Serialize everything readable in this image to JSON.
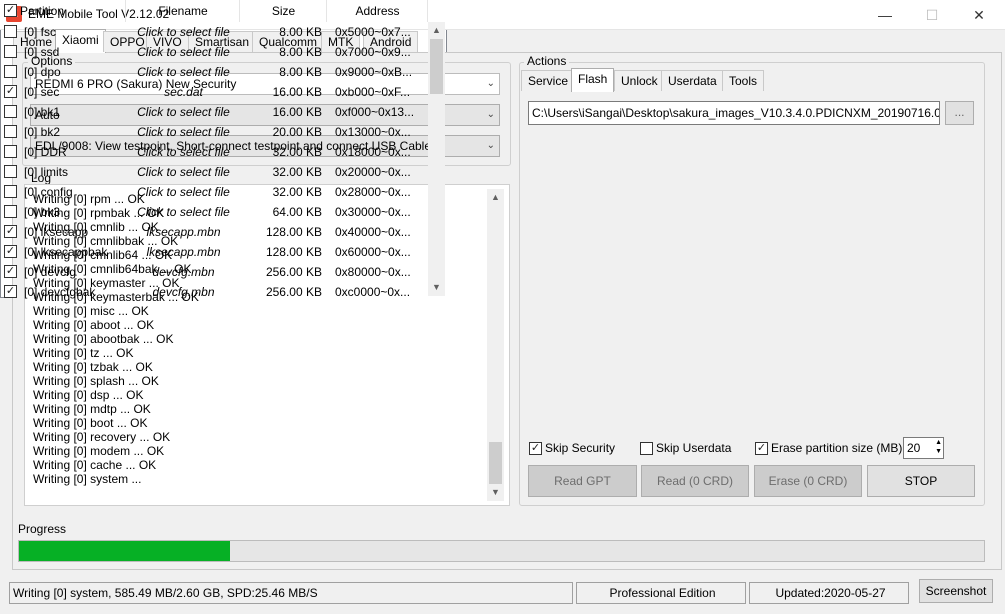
{
  "window": {
    "title": "EME Mobile Tool V2.12.02",
    "minimize": "—",
    "maximize": "☐",
    "close": "✕"
  },
  "tabs": [
    "Home",
    "Xiaomi",
    "OPPO",
    "VIVO",
    "Smartisan",
    "Qualcomm",
    "MTK",
    "Android"
  ],
  "options": {
    "label": "Options",
    "device": "REDMI 6 PRO (Sakura) New Security",
    "mode": "Auto",
    "connection": "EDL/9008: View testpoint, Short-connect testpoint and connect USB Cable"
  },
  "log": {
    "label": "Log",
    "lines": [
      "Writing [0] rpm ... OK",
      "Writing [0] rpmbak ... OK",
      "Writing [0] cmnlib ... OK",
      "Writing [0] cmnlibbak ... OK",
      "Writing [0] cmnlib64 ... OK",
      "Writing [0] cmnlib64bak ... OK",
      "Writing [0] keymaster ... OK",
      "Writing [0] keymasterbak ... OK",
      "Writing [0] misc ... OK",
      "Writing [0] aboot ... OK",
      "Writing [0] abootbak ... OK",
      "Writing [0] tz ... OK",
      "Writing [0] tzbak ... OK",
      "Writing [0] splash ... OK",
      "Writing [0] dsp ... OK",
      "Writing [0] mdtp ... OK",
      "Writing [0] boot ... OK",
      "Writing [0] recovery ... OK",
      "Writing [0] modem ... OK",
      "Writing [0] cache ... OK",
      "Writing [0] system ..."
    ]
  },
  "actions": {
    "label": "Actions",
    "subtabs": [
      "Service",
      "Flash",
      "Unlock",
      "Userdata",
      "Tools"
    ],
    "path": "C:\\Users\\iSangai\\Desktop\\sakura_images_V10.3.4.0.PDICNXM_20190716.0",
    "browse_label": "...",
    "table": {
      "headers": {
        "partition": "Partition",
        "filename": "Filename",
        "size": "Size",
        "address": "Address"
      },
      "rows": [
        {
          "checked": false,
          "partition": "[0] fsc",
          "filename": "Click to select file",
          "size": "8.00 KB",
          "address": "0x5000~0x7..."
        },
        {
          "checked": false,
          "partition": "[0] ssd",
          "filename": "Click to select file",
          "size": "8.00 KB",
          "address": "0x7000~0x9..."
        },
        {
          "checked": false,
          "partition": "[0] dpo",
          "filename": "Click to select file",
          "size": "8.00 KB",
          "address": "0x9000~0xB..."
        },
        {
          "checked": true,
          "partition": "[0] sec",
          "filename": "sec.dat",
          "size": "16.00 KB",
          "address": "0xb000~0xF..."
        },
        {
          "checked": false,
          "partition": "[0] bk1",
          "filename": "Click to select file",
          "size": "16.00 KB",
          "address": "0xf000~0x13..."
        },
        {
          "checked": false,
          "partition": "[0] bk2",
          "filename": "Click to select file",
          "size": "20.00 KB",
          "address": "0x13000~0x..."
        },
        {
          "checked": false,
          "partition": "[0] DDR",
          "filename": "Click to select file",
          "size": "32.00 KB",
          "address": "0x18000~0x..."
        },
        {
          "checked": false,
          "partition": "[0] limits",
          "filename": "Click to select file",
          "size": "32.00 KB",
          "address": "0x20000~0x..."
        },
        {
          "checked": false,
          "partition": "[0] config",
          "filename": "Click to select file",
          "size": "32.00 KB",
          "address": "0x28000~0x..."
        },
        {
          "checked": false,
          "partition": "[0] bk3",
          "filename": "Click to select file",
          "size": "64.00 KB",
          "address": "0x30000~0x..."
        },
        {
          "checked": true,
          "partition": "[0] lksecapp",
          "filename": "lksecapp.mbn",
          "size": "128.00 KB",
          "address": "0x40000~0x..."
        },
        {
          "checked": true,
          "partition": "[0] lksecappbak",
          "filename": "lksecapp.mbn",
          "size": "128.00 KB",
          "address": "0x60000~0x..."
        },
        {
          "checked": true,
          "partition": "[0] devcfg",
          "filename": "devcfg.mbn",
          "size": "256.00 KB",
          "address": "0x80000~0x..."
        },
        {
          "checked": true,
          "partition": "[0] devcfgbak",
          "filename": "devcfg.mbn",
          "size": "256.00 KB",
          "address": "0xc0000~0x..."
        }
      ]
    },
    "skip_security": {
      "label": "Skip Security",
      "checked": true
    },
    "skip_userdata": {
      "label": "Skip Userdata",
      "checked": false
    },
    "erase_partition": {
      "label": "Erase partition size (MB)",
      "checked": true,
      "value": "20"
    },
    "buttons": {
      "read_gpt": "Read GPT",
      "read": "Read (0 CRD)",
      "erase": "Erase (0 CRD)",
      "stop": "STOP"
    }
  },
  "progress": {
    "label": "Progress",
    "fraction": 0.219
  },
  "status": {
    "message": "Writing [0] system, 585.49 MB/2.60 GB, SPD:25.46 MB/S",
    "edition": "Professional Edition",
    "updated": "Updated:2020-05-27",
    "screenshot": "Screenshot"
  },
  "colors": {
    "progress": "#06b025",
    "app_icon": "#e8452f"
  }
}
